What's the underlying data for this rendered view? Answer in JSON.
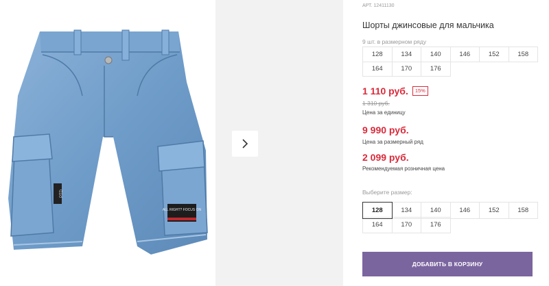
{
  "product": {
    "article": "АРТ. 12411130",
    "title": "Шорты джинсовые для мальчика",
    "pack_info": "9 шт. в размерном ряду",
    "image_alt": "jeans-shorts-photo",
    "patch_text": "ALL RIGHT? FOCUS ON",
    "tag_text": "PTD"
  },
  "size_range": [
    "128",
    "134",
    "140",
    "146",
    "152",
    "158",
    "164",
    "170",
    "176"
  ],
  "pricing": {
    "price": "1 110 руб.",
    "discount": "15%",
    "old_price": "1 310 руб.",
    "price_label": "Цена за единицу",
    "range_price": "9 990 руб.",
    "range_label": "Цена за размерный ряд",
    "rrp": "2 099 руб.",
    "rrp_label": "Рекомендуемая розничная цена"
  },
  "size_select": {
    "label": "Выберите размер:",
    "selected": "128",
    "options": [
      "128",
      "134",
      "140",
      "146",
      "152",
      "158",
      "164",
      "170",
      "176"
    ]
  },
  "actions": {
    "add_to_cart": "ДОБАВИТЬ В КОРЗИНУ"
  },
  "colors": {
    "price_red": "#d82a3a",
    "button_purple": "#7b659f",
    "denim": "#6f9cc9"
  }
}
